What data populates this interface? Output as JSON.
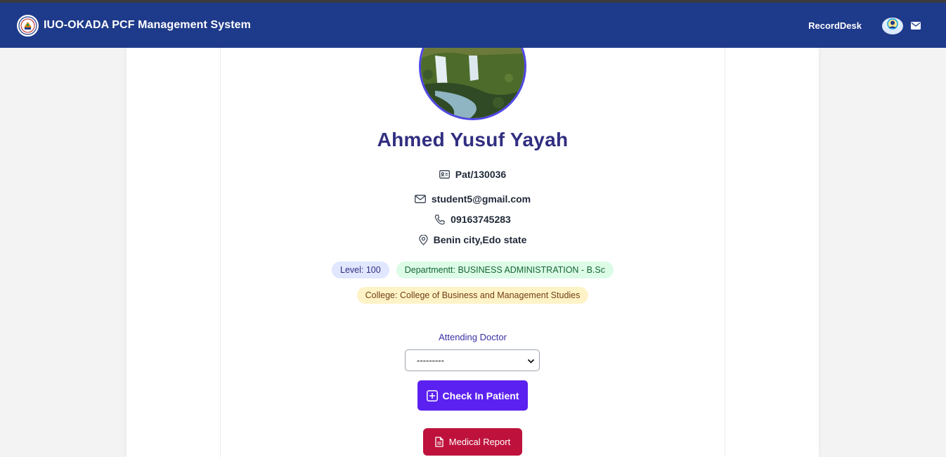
{
  "navbar": {
    "title": "IUO-OKADA PCF Management System",
    "link": "RecordDesk",
    "logo_icon": "university-seal-icon",
    "avatar_icon": "user-avatar-icon",
    "mail_icon": "envelope-icon",
    "bg_color": "#1e3a8a"
  },
  "patient": {
    "photo_icon": "waterfall-landscape-photo",
    "name": "Ahmed Yusuf Yayah",
    "id": "Pat/130036",
    "email": "student5@gmail.com",
    "phone": "09163745283",
    "address": "Benin city,Edo state"
  },
  "badges": {
    "level": "Level: 100",
    "department": "Departmentt: BUSINESS ADMINISTRATION - B.Sc",
    "college": "College: College of Business and Management Studies"
  },
  "checkin": {
    "doctor_label": "Attending Doctor",
    "doctor_selected": "---------",
    "button_label": "Check In Patient",
    "button_color": "#5b21f0"
  },
  "report": {
    "button_label": "Medical Report",
    "button_color": "#be123c"
  }
}
